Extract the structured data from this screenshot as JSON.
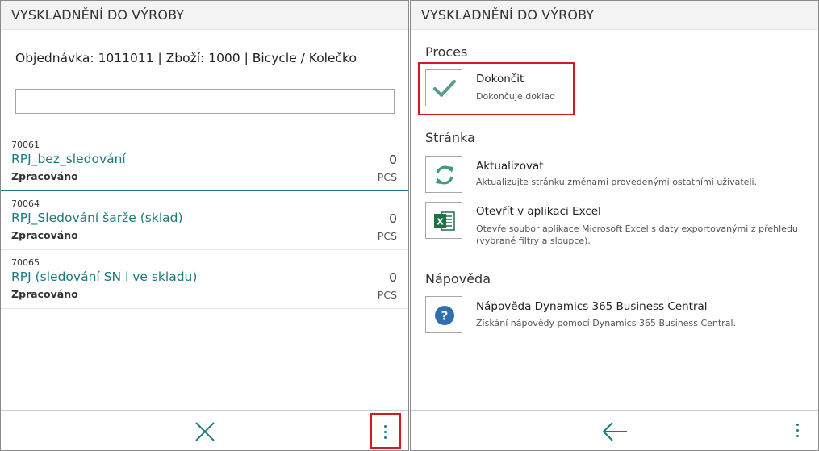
{
  "left": {
    "title": "VYSKLADNĚNÍ DO VÝROBY",
    "order_info": "Objednávka: 1011011 | Zboží: 1000 | Bicycle / Kolečko",
    "search": {
      "value": "",
      "placeholder": ""
    },
    "items": [
      {
        "code": "70061",
        "name": "RPJ_bez_sledování",
        "status": "Zpracováno",
        "qty": "0",
        "uom": "PCS"
      },
      {
        "code": "70064",
        "name": "RPJ_Sledování šarže (sklad)",
        "status": "Zpracováno",
        "qty": "0",
        "uom": "PCS"
      },
      {
        "code": "70065",
        "name": "RPJ (sledování SN i ve skladu)",
        "status": "Zpracováno",
        "qty": "0",
        "uom": "PCS"
      }
    ],
    "footer": {
      "close_icon": "close-icon",
      "more_icon": "more-vertical-icon"
    }
  },
  "right": {
    "title": "VYSKLADNĚNÍ DO VÝROBY",
    "sections": [
      {
        "title": "Proces",
        "actions": [
          {
            "label": "Dokončit",
            "desc": "Dokončuje doklad",
            "icon": "checkmark-icon"
          }
        ]
      },
      {
        "title": "Stránka",
        "actions": [
          {
            "label": "Aktualizovat",
            "desc": "Aktualizujte stránku změnami provedenými ostatními uživateli.",
            "icon": "refresh-icon"
          },
          {
            "label": "Otevřít v aplikaci Excel",
            "desc": "Otevře soubor aplikace Microsoft Excel s daty exportovanými z přehledu (vybrané filtry a sloupce).",
            "icon": "excel-icon"
          }
        ]
      },
      {
        "title": "Nápověda",
        "actions": [
          {
            "label": "Nápověda Dynamics 365 Business Central",
            "desc": "Získání nápovědy pomocí Dynamics 365 Business Central.",
            "icon": "help-icon"
          }
        ]
      }
    ],
    "footer": {
      "back_icon": "back-arrow-icon",
      "more_icon": "more-vertical-icon"
    }
  },
  "colors": {
    "accent": "#1c7a7e",
    "highlight": "#d71920",
    "title_bar": "#f3f3f3"
  }
}
